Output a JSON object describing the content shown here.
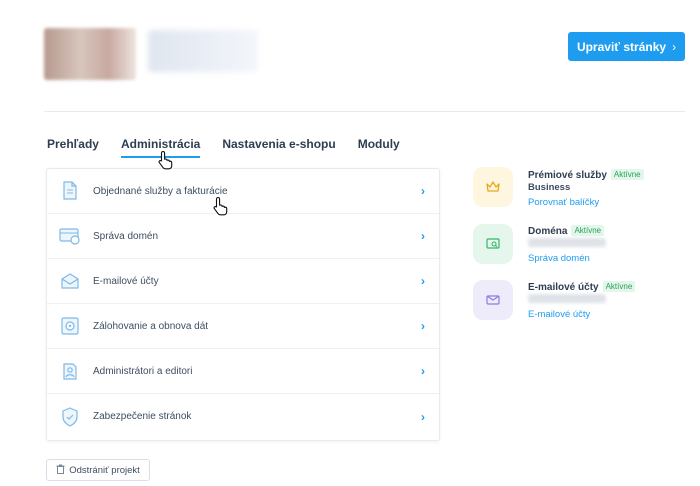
{
  "header": {
    "edit_button_label": "Upraviť stránky",
    "edit_button_chevron": "›"
  },
  "tabs": [
    {
      "label": "Prehľady",
      "active": false
    },
    {
      "label": "Administrácia",
      "active": true
    },
    {
      "label": "Nastavenia e-shopu",
      "active": false
    },
    {
      "label": "Moduly",
      "active": false
    }
  ],
  "admin_menu": {
    "items": [
      {
        "label": "Objednané služby a fakturácie",
        "icon": "document-icon"
      },
      {
        "label": "Správa domén",
        "icon": "domain-card-icon"
      },
      {
        "label": "E-mailové účty",
        "icon": "mail-icon"
      },
      {
        "label": "Zálohovanie a obnova dát",
        "icon": "safe-icon"
      },
      {
        "label": "Administrátori a editori",
        "icon": "admin-users-icon"
      },
      {
        "label": "Zabezpečenie stránok",
        "icon": "shield-icon"
      }
    ],
    "arrow": "›"
  },
  "services": [
    {
      "title": "Prémiové služby",
      "status": "Aktívne",
      "subtitle": "Business",
      "link": "Porovnať balíčky",
      "icon": "crown-icon",
      "icon_bg": "#fff6df",
      "icon_color": "#e8a81c"
    },
    {
      "title": "Doména",
      "status": "Aktívne",
      "link": "Správa domén",
      "icon": "domain-search-icon",
      "icon_bg": "#e5f7ec",
      "icon_color": "#35b56a"
    },
    {
      "title": "E-mailové účty",
      "status": "Aktívne",
      "link": "E-mailové účty",
      "icon": "envelope-icon",
      "icon_bg": "#eeebfb",
      "icon_color": "#8d7de0"
    }
  ],
  "footer": {
    "remove_project_label": "Odstrániť projekt"
  },
  "colors": {
    "accent": "#1e9cf0",
    "active_status": "#27a35a"
  }
}
